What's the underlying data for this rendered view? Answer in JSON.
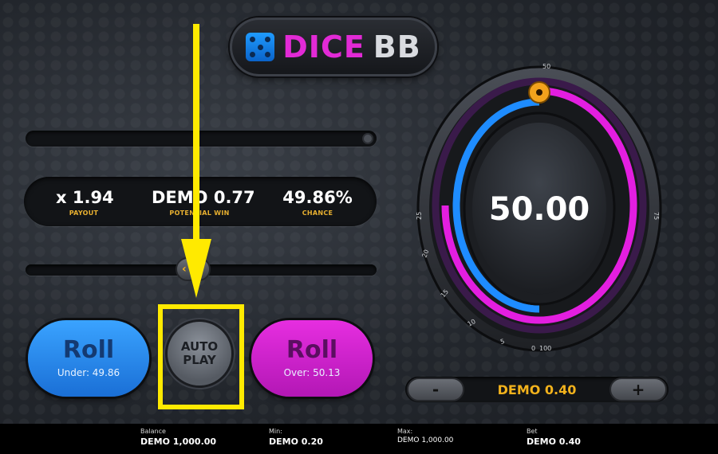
{
  "logo": {
    "word1": "DICE",
    "word2": "BB"
  },
  "stats": {
    "payout": {
      "value": "x 1.94",
      "label": "PAYOUT"
    },
    "potential_win": {
      "value": "DEMO 0.77",
      "label": "POTENTIAL WIN"
    },
    "chance": {
      "value": "49.86%",
      "label": "CHANCE"
    }
  },
  "roll_under": {
    "label": "Roll",
    "sub": "Under: 49.86"
  },
  "roll_over": {
    "label": "Roll",
    "sub": "Over: 50.13"
  },
  "autoplay": {
    "line1": "AUTO",
    "line2": "PLAY"
  },
  "wheel": {
    "value": "50.00",
    "ticks": [
      "50",
      "75",
      "25",
      "20",
      "15",
      "10",
      "5",
      "0",
      "100"
    ],
    "under_color": "#1e8cff",
    "over_color": "#e31ee0",
    "marker_color": "#f2a21c"
  },
  "bet_controls": {
    "minus": "-",
    "plus": "+",
    "value": "DEMO 0.40"
  },
  "footer": {
    "balance": {
      "label": "Balance",
      "value": "DEMO 1,000.00"
    },
    "min": {
      "label": "Min:",
      "value": "DEMO 0.20"
    },
    "max": {
      "label": "Max:",
      "value": "DEMO 1,000.00"
    },
    "bet": {
      "label": "Bet",
      "value": "DEMO 0.40"
    }
  },
  "annotation": {
    "color": "#ffea00"
  }
}
